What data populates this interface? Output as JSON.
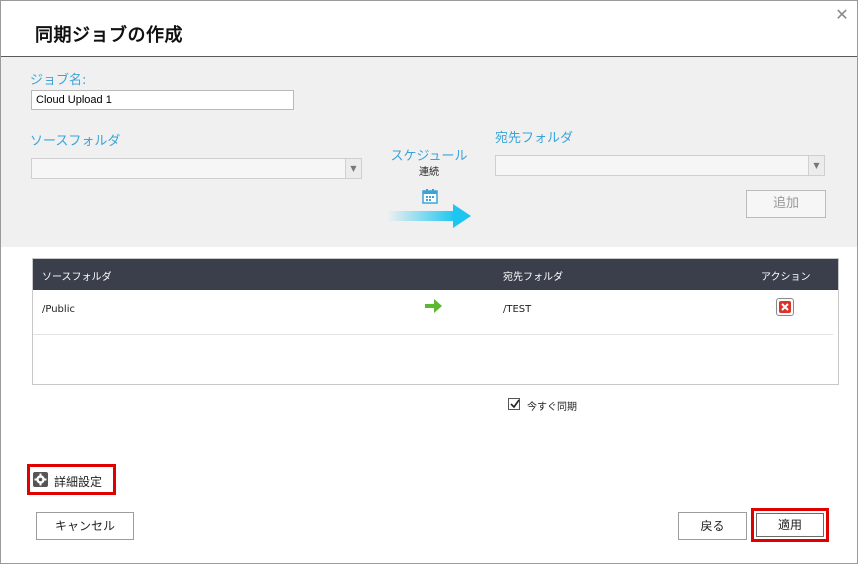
{
  "dialog": {
    "title": "同期ジョブの作成",
    "close_icon": "close-icon"
  },
  "form": {
    "job_name_label": "ジョブ名:",
    "job_name_value": "Cloud Upload 1",
    "source_folder_label": "ソースフォルダ",
    "source_folder_value": "",
    "dest_folder_label": "宛先フォルダ",
    "dest_folder_value": "",
    "schedule_label": "スケジュール",
    "schedule_value": "連続",
    "add_button": "追加"
  },
  "table": {
    "columns": [
      "ソースフォルダ",
      "宛先フォルダ",
      "アクション"
    ],
    "rows": [
      {
        "source": "/Public",
        "destination": "/TEST",
        "action_icon": "delete-icon"
      }
    ]
  },
  "sync_now": {
    "label": "今すぐ同期",
    "checked": true
  },
  "advanced": {
    "label": "詳細設定",
    "icon": "gear-icon"
  },
  "buttons": {
    "cancel": "キャンセル",
    "back": "戻る",
    "apply": "適用"
  },
  "colors": {
    "accent_blue": "#3ca3d8",
    "table_header": "#3b3f4c",
    "highlight_red": "#e00000",
    "arrow_green": "#5cb82f",
    "delete_red": "#d9342b"
  }
}
